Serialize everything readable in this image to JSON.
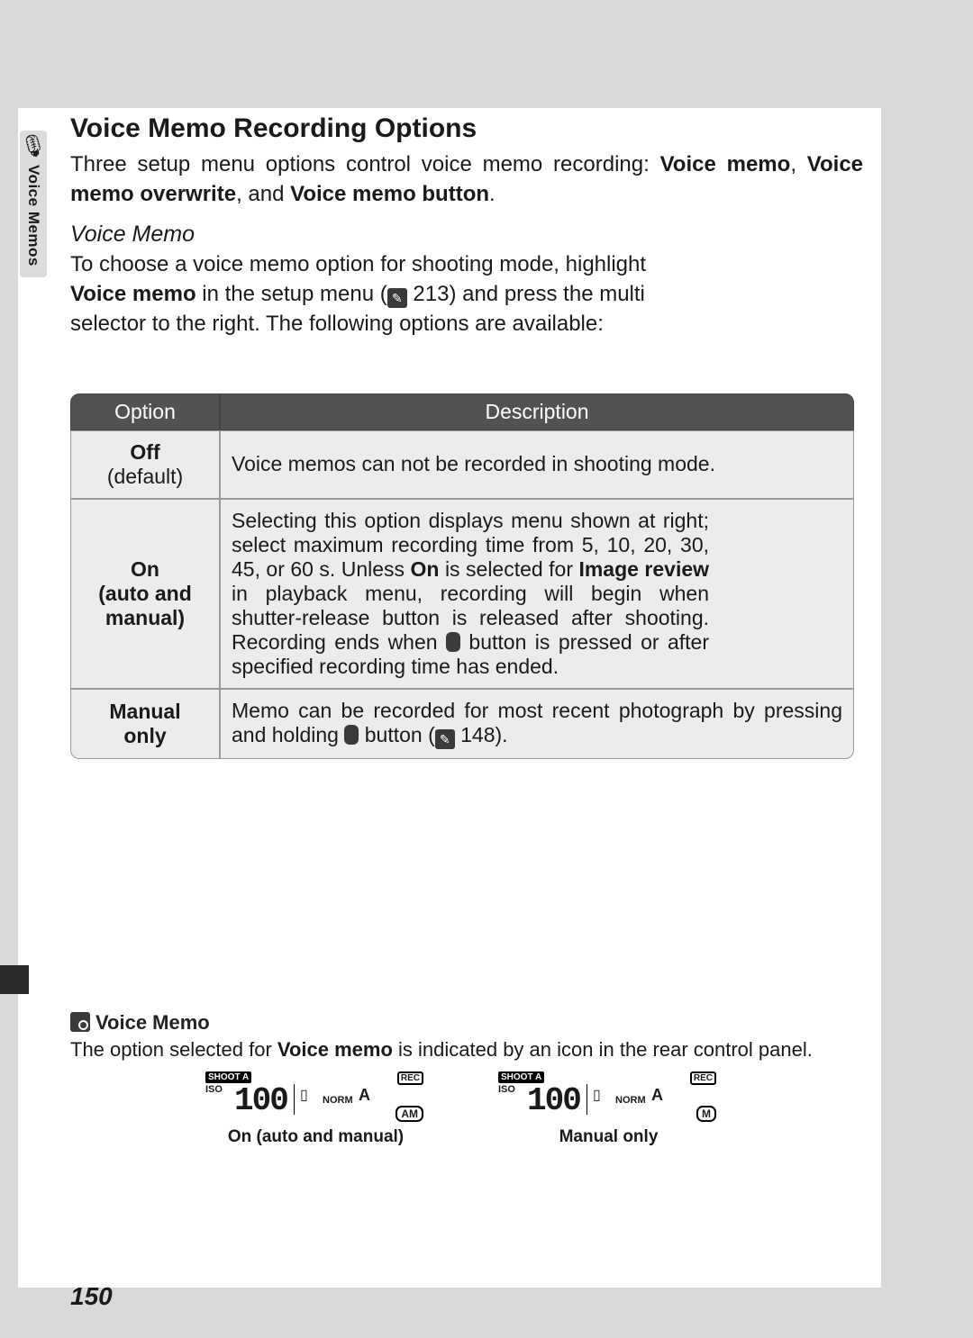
{
  "sidetab": {
    "icon": "🎙",
    "label": "Voice Memos"
  },
  "heading": "Voice Memo Recording Options",
  "intro": {
    "pre": "Three setup menu options control voice memo recording: ",
    "b1": "Voice memo",
    "sep1": ", ",
    "b2": "Voice memo overwrite",
    "sep2": ", and ",
    "b3": "Voice memo button",
    "post": "."
  },
  "voice": {
    "subhead": "Voice Memo",
    "l1a": "To choose a voice memo option for shooting mode, highlight ",
    "l1b": "Voice memo",
    "l1c": " in the setup menu (",
    "ref": "213",
    "l1d": ") and press the multi selector to the right. The following options are available:"
  },
  "table": {
    "h1": "Option",
    "h2": "Description",
    "r1": {
      "opt_b": "Off",
      "opt_s": "(default)",
      "desc": "Voice memos can not be recorded in shooting mode."
    },
    "r2": {
      "opt_b1": "On",
      "opt_b2": "(auto and manual)",
      "d_a": "Selecting this option displays menu shown at right; select maximum recording time from 5, 10, 20, 30, 45, or 60 s.  Unless ",
      "d_b1": "On",
      "d_b": " is selected for ",
      "d_b2": "Image review",
      "d_c": " in playback menu, recording will begin when shutter-release button is released after shooting.  Recording ends when ",
      "d_d": " button is pressed or after specified recording time has ended."
    },
    "r3": {
      "opt_b1": "Manual",
      "opt_b2": "only",
      "d_a": "Memo can be recorded for most recent photograph by pressing and holding ",
      "d_b": " button (",
      "ref": "148",
      "d_c": ")."
    }
  },
  "note": {
    "head": "Voice Memo",
    "b_a": "The option selected for ",
    "b_b": "Voice memo",
    "b_c": " is indicated by an icon in the rear control panel."
  },
  "panel": {
    "shoot": "SHOOT A",
    "iso": "ISO",
    "num": "100",
    "norm": "NORM",
    "a": "A",
    "rec": "REC",
    "mode1": "AM",
    "mode2": "M",
    "cap1": "On (auto and manual)",
    "cap2": "Manual only"
  },
  "pagenum": "150"
}
